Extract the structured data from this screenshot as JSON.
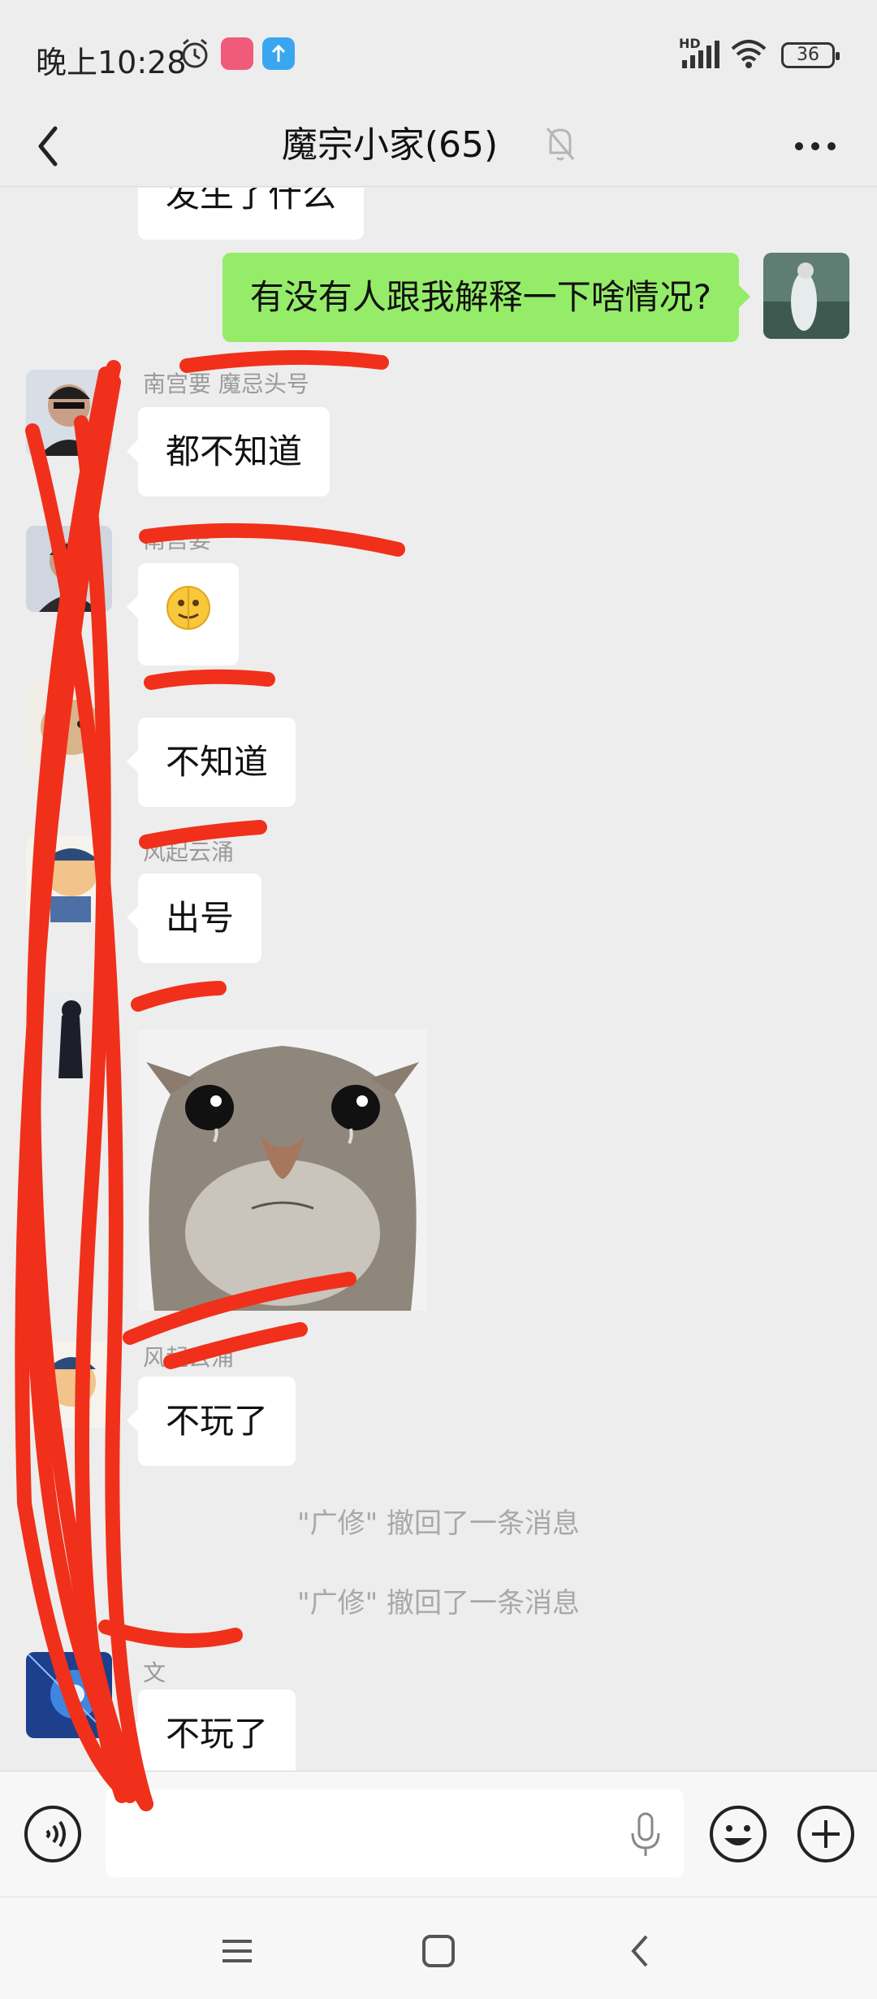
{
  "status_bar": {
    "time": "晚上10:28",
    "network": "HD",
    "battery": "36",
    "icons": [
      "alarm-icon",
      "app-badge-icon",
      "upload-icon",
      "signal-icon",
      "wifi-icon",
      "battery-icon"
    ]
  },
  "header": {
    "title": "魔宗小家(65)",
    "icons": [
      "back-icon",
      "mute-bell-icon",
      "more-icon"
    ]
  },
  "messages": [
    {
      "type": "text",
      "side": "left",
      "text": "发生了什么",
      "partial": true
    },
    {
      "type": "text",
      "side": "right",
      "text": "有没有人跟我解释一下啥情况?"
    },
    {
      "type": "text",
      "side": "left",
      "sender": "南宫要 魔忌头号",
      "text": "都不知道"
    },
    {
      "type": "emoji",
      "side": "left",
      "sender": "南宫要",
      "emoji": "🫠"
    },
    {
      "type": "text",
      "side": "left",
      "sender": "",
      "text": "不知道"
    },
    {
      "type": "text",
      "side": "left",
      "sender": "风起云涌",
      "text": "出号"
    },
    {
      "type": "image",
      "side": "left",
      "sender": "",
      "description": "crying-cat-sticker"
    },
    {
      "type": "text",
      "side": "left",
      "sender": "风起云涌",
      "text": "不玩了"
    },
    {
      "type": "system",
      "text": "\"广修\" 撤回了一条消息"
    },
    {
      "type": "system",
      "text": "\"广修\" 撤回了一条消息"
    },
    {
      "type": "text",
      "side": "left",
      "sender": "文",
      "text": "不玩了"
    }
  ],
  "input_bar": {
    "placeholder": "",
    "icons": [
      "voice-icon",
      "mic-icon",
      "emoji-icon",
      "plus-icon"
    ]
  },
  "nav_bar": {
    "icons": [
      "menu-icon",
      "home-icon",
      "back-nav-icon"
    ]
  },
  "colors": {
    "chat_bg": "#ededed",
    "my_bubble": "#95ec69",
    "their_bubble": "#ffffff",
    "scribble": "#f0301a"
  }
}
